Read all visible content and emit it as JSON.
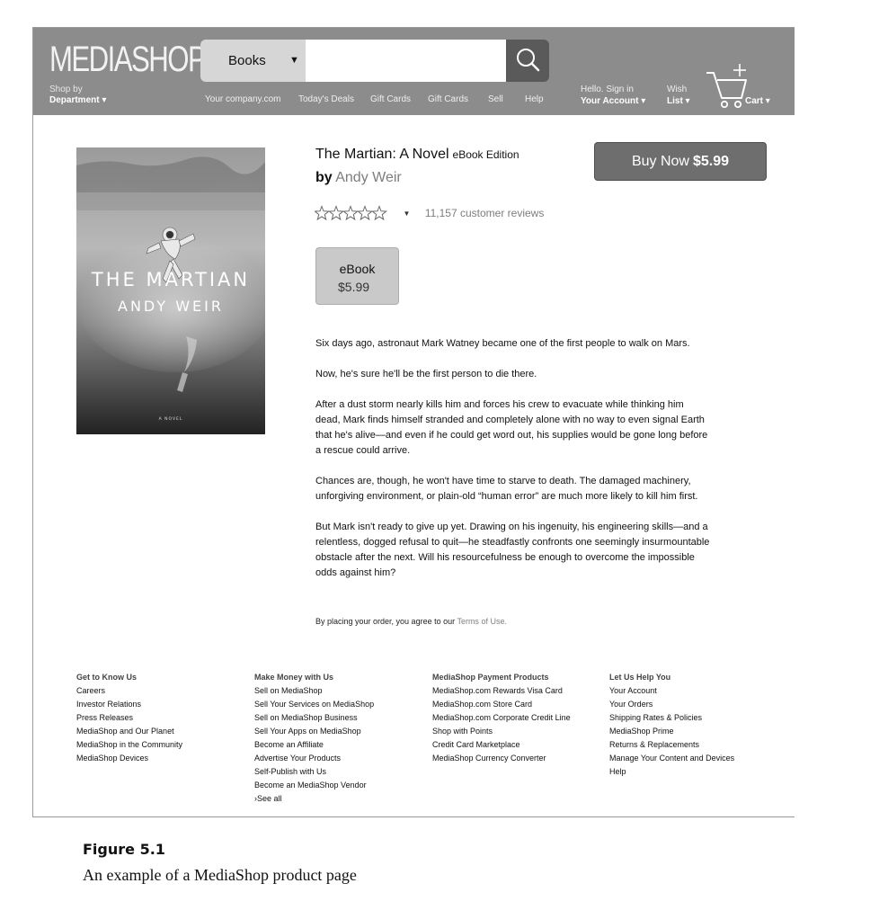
{
  "header": {
    "logo": "MEDIASHOP",
    "shop_by": "Shop by",
    "department": "Department ▾",
    "search_category": "Books",
    "search_placeholder": "",
    "nav": [
      "Your company.com",
      "Today's Deals",
      "Gift Cards",
      "Gift Cards",
      "Sell",
      "Help"
    ],
    "greeting": "Hello. Sign in",
    "account": "Your Account ▾",
    "wish": "Wish",
    "list": "List ▾",
    "cart": "Cart ▾"
  },
  "product": {
    "cover_title": "THE MARTIAN",
    "cover_author": "ANDY WEIR",
    "cover_tag": "A NOVEL",
    "title": "The Martian: A Novel",
    "edition": "eBook Edition",
    "by": "by",
    "author": "Andy Weir",
    "rating_stars": 0,
    "reviews": "11,157 customer reviews",
    "buy_label": "Buy Now",
    "buy_price": "$5.99",
    "format": "eBook",
    "format_price": "$5.99",
    "description": [
      "Six days ago, astronaut Mark Watney became one of the first people to walk on Mars.",
      "Now, he's sure he'll be the first person to die there.",
      "After a dust storm nearly kills him and forces his crew to evacuate while thinking him dead, Mark finds himself stranded and completely alone with no way to even signal Earth that he's alive—and even if he could get word out, his supplies would be gone long before a rescue could arrive.",
      "Chances are, though, he won't have time to starve to death. The damaged machinery, unforgiving environment, or plain-old “human error” are much more likely to kill him first.",
      "But Mark isn't ready to give up yet. Drawing on his ingenuity, his engineering skills—and a relentless, dogged refusal to quit—he steadfastly confronts one seemingly insurmountable obstacle after the next. Will his resourcefulness be enough to overcome the impossible odds against him?"
    ],
    "terms_text": "By placing your order, you agree to our ",
    "terms_link": "Terms of Use."
  },
  "footer": {
    "col1": {
      "heading": "Get to Know Us",
      "items": [
        "Careers",
        "Investor Relations",
        "Press Releases",
        "MediaShop and Our Planet",
        "MediaShop in the Community",
        "MediaShop Devices"
      ]
    },
    "col2": {
      "heading": "Make Money with Us",
      "items": [
        "Sell on MediaShop",
        "Sell Your Services on MediaShop",
        "Sell on MediaShop Business",
        "Sell Your Apps on MediaShop",
        "Become an Affiliate",
        "Advertise Your Products",
        "Self-Publish with Us",
        "Become an MediaShop Vendor",
        "›See all"
      ]
    },
    "col3": {
      "heading": "MediaShop Payment Products",
      "items": [
        "MediaShop.com Rewards Visa Card",
        "MediaShop.com Store Card",
        "MediaShop.com Corporate Credit Line",
        "Shop with Points",
        "Credit Card Marketplace",
        "MediaShop Currency Converter"
      ]
    },
    "col4": {
      "heading": "Let Us Help You",
      "items": [
        "Your Account",
        "Your Orders",
        "Shipping Rates & Policies",
        "MediaShop Prime",
        "Returns & Replacements",
        "Manage Your Content and Devices",
        "Help"
      ]
    }
  },
  "caption": {
    "label": "Figure 5.1",
    "text": "An example of a MediaShop product page"
  },
  "colors": {
    "header_bg": "#8c8c8c",
    "buy_button": "#6e6e6e",
    "link_gray": "#7d7d7d"
  }
}
